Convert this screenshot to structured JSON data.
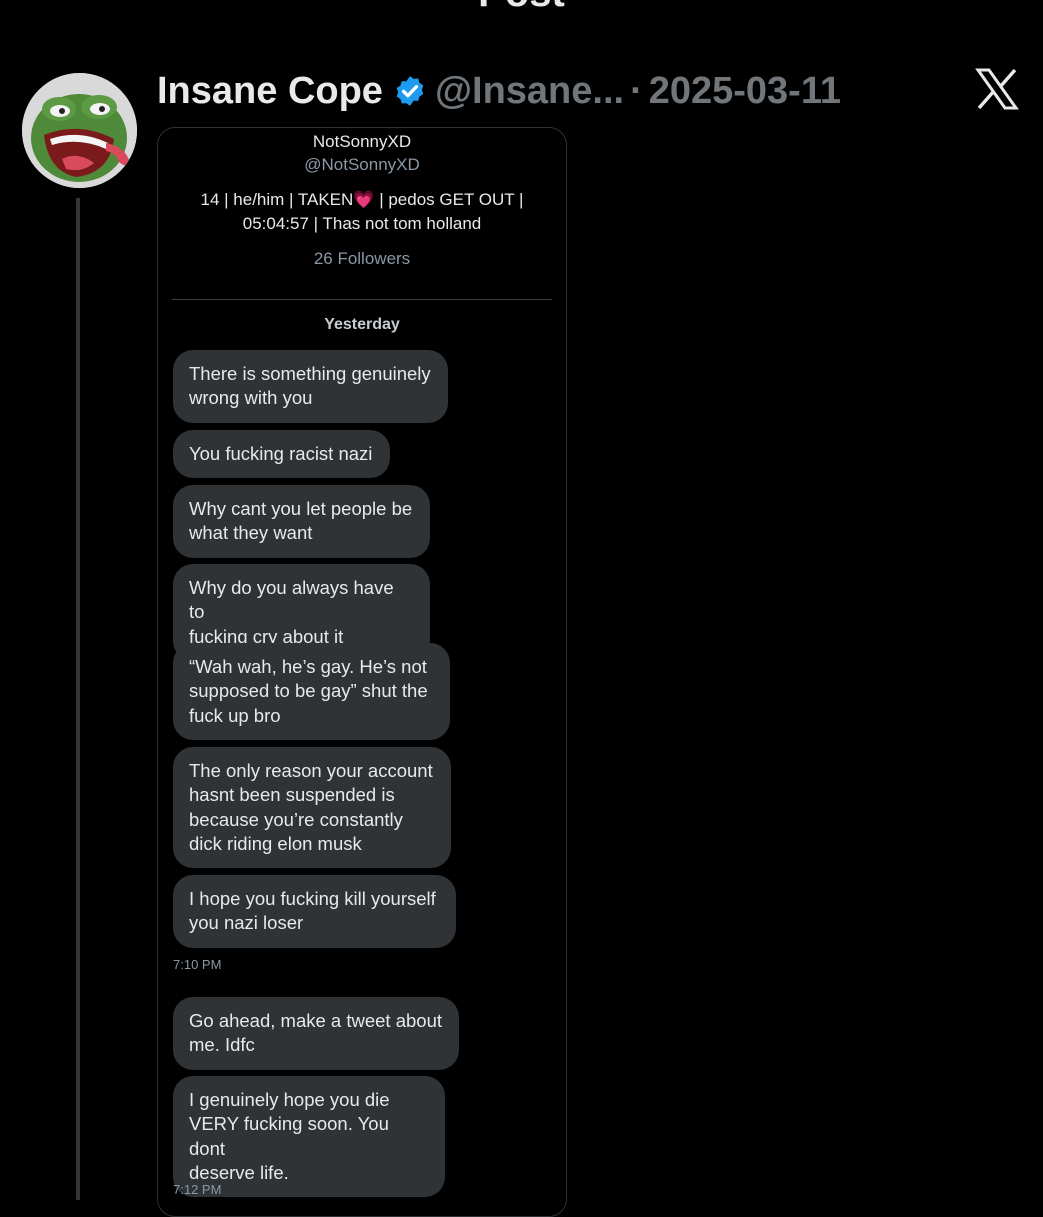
{
  "top_bar": {
    "title": "Post",
    "back_icon": "‹"
  },
  "post": {
    "display_name": "Insane Cope",
    "handle": "@Insane...",
    "separator": "·",
    "date": "2025-03-11",
    "verified_color": "#1d9bf0"
  },
  "dm_profile": {
    "name": "NotSonnyXD",
    "handle": "@NotSonnyXD",
    "bio_line1": "14 | he/him | TAKEN",
    "bio_emoji": "💗",
    "bio_line1_end": " | pedos GET OUT |",
    "bio_line2": "05:04:57 | Thas not tom holland",
    "followers": "26 Followers"
  },
  "day_label": "Yesterday",
  "messages": [
    {
      "text": "There is something genuinely\nwrong with you"
    },
    {
      "text": "You fucking racist nazi"
    },
    {
      "text": "Why cant you let people be\nwhat they want"
    },
    {
      "text": "Why do you always have to\nfucking cry about it"
    },
    {
      "text": "“Wah wah, he’s gay. He’s not\nsupposed to be gay” shut the\nfuck up bro"
    },
    {
      "text": "The only reason your account\nhasnt been suspended is\nbecause you’re constantly\ndick riding elon musk"
    },
    {
      "text": "I hope you fucking kill yourself\nyou nazi loser"
    },
    {
      "text": "Go ahead, make a tweet about\nme. Idfc"
    },
    {
      "text": "I genuinely hope you die\nVERY fucking soon. You dont\ndeserve life."
    }
  ],
  "timestamps": [
    "7:10 PM",
    "7:12 PM"
  ],
  "colors": {
    "background": "#000000",
    "bubble": "#2f3336",
    "muted": "#71767b"
  }
}
